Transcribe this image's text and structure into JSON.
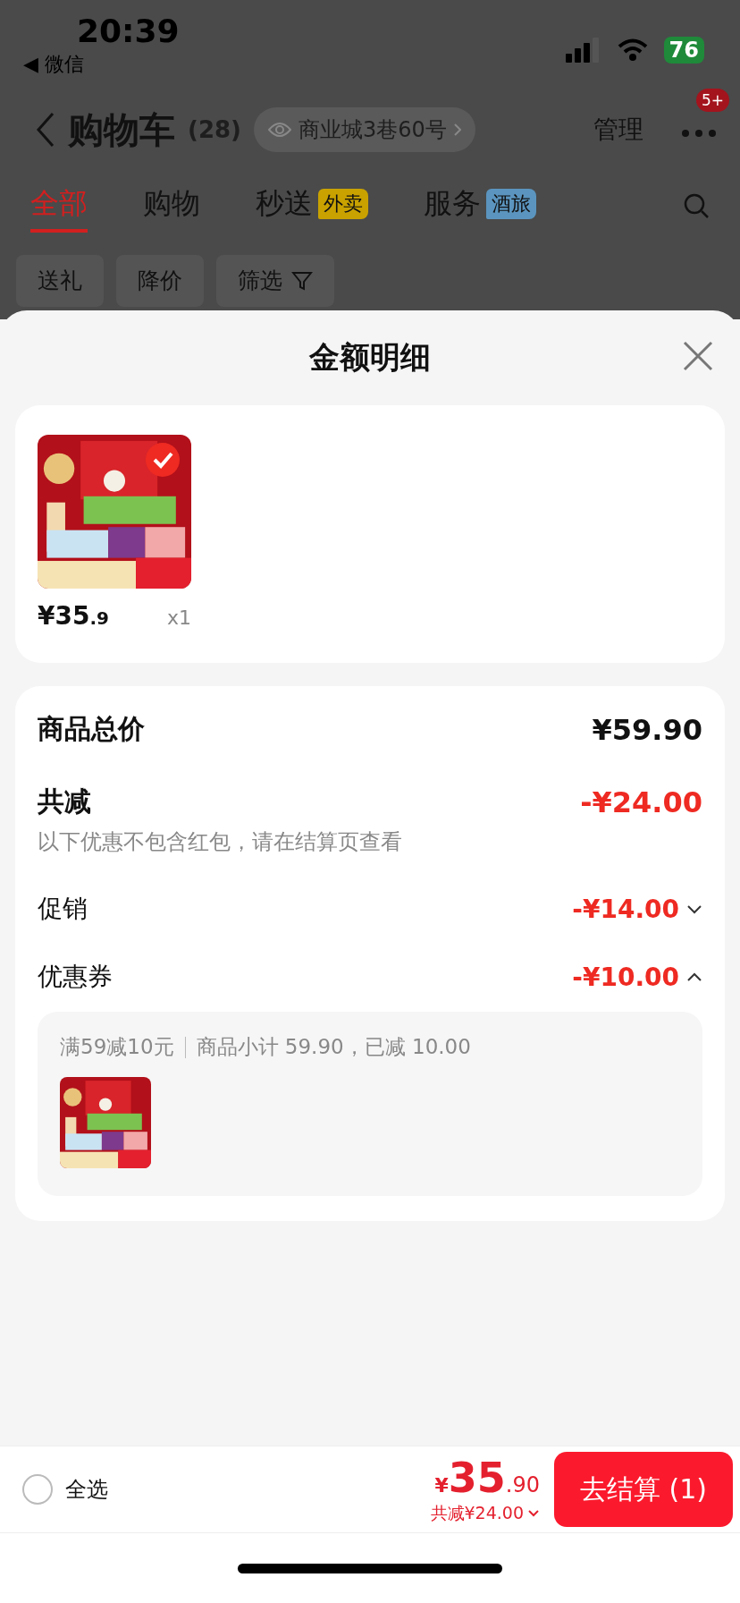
{
  "status_bar": {
    "time": "20:39",
    "back_label": "◀ 微信",
    "battery": "76"
  },
  "header": {
    "title": "购物车",
    "count": "(28)",
    "address": "商业城3巷60号",
    "manage": "管理",
    "more_badge": "5+"
  },
  "tabs": [
    {
      "label": "全部",
      "selected": true
    },
    {
      "label": "购物",
      "selected": false
    },
    {
      "label": "秒送",
      "tag": "外卖",
      "color": "#c9a200"
    },
    {
      "label": "服务",
      "tag": "酒旅",
      "color": "#5b95bf"
    }
  ],
  "filters": [
    {
      "label": "送礼",
      "kind": "plain"
    },
    {
      "label": "降价",
      "kind": "plain"
    },
    {
      "label": "筛选",
      "kind": "filter"
    }
  ],
  "sheet": {
    "title": "金额明细",
    "items": [
      {
        "price_main": "¥35",
        "price_decimal": ".9",
        "quantity": "x1",
        "selected": true
      }
    ],
    "summary": {
      "total_label": "商品总价",
      "total": "¥59.90",
      "discount_label": "共减",
      "discount": "-¥24.00",
      "note": "以下优惠不包含红包，请在结算页查看",
      "lines": [
        {
          "label": "促销",
          "amount": "-¥14.00",
          "expanded": false
        },
        {
          "label": "优惠券",
          "amount": "-¥10.00",
          "expanded": true,
          "detail": {
            "rule": "满59减10元",
            "info": "商品小计 59.90，已减 10.00"
          }
        }
      ]
    }
  },
  "footer": {
    "select_all": {
      "label": "全选",
      "checked": false
    },
    "currency": "¥",
    "total_main": "35",
    "total_decimal": ".90",
    "discount": "共减¥24.00",
    "checkout": "去结算 (1)"
  }
}
